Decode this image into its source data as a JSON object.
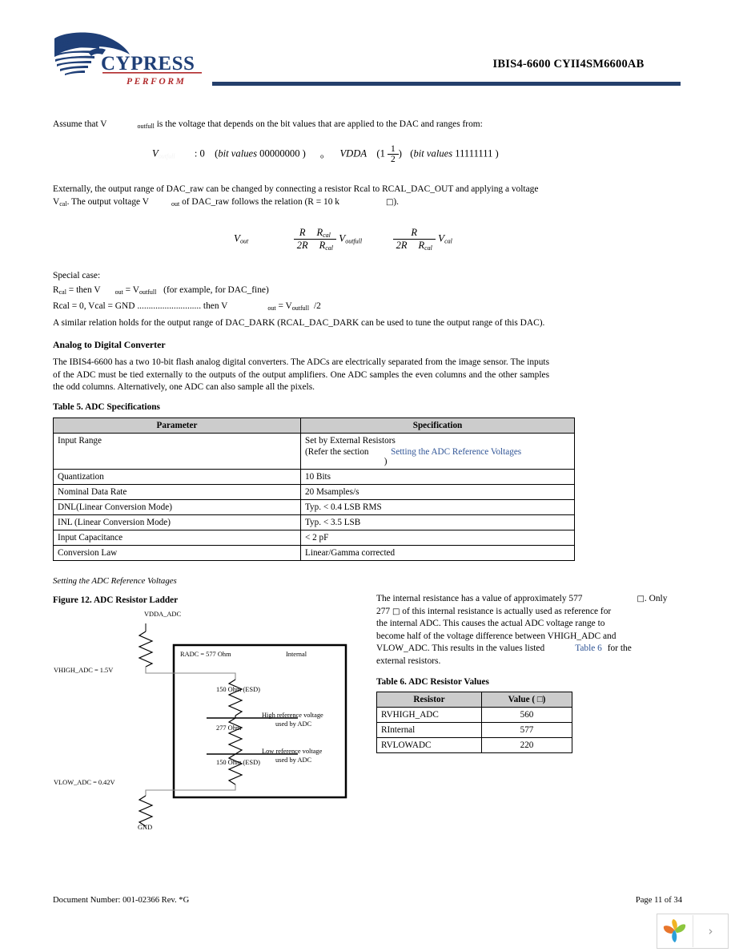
{
  "header": {
    "title": "IBIS4-6600 CYII4SM6600AB",
    "logo_name": "CYPRESS",
    "logo_tagline": "PERFORM",
    "accent_color": "#243f6c"
  },
  "body": {
    "assume_line": {
      "prefix": "Assume that V",
      "subscript": "outfull",
      "suffix": "is the voltage that depends on the bit values that are applied to the DAC and ranges from:"
    },
    "formula_range": {
      "var": "V",
      "var_sub": "outfull",
      "low": ": 0",
      "low_bits_label": "bit values",
      "low_bits": "00000000",
      "op": "o",
      "high_ref": "VDDA",
      "high_paren_open": "(1",
      "frac_num": "1",
      "frac_den": "2",
      "high_paren_close": ")",
      "high_bits_label": "bit values",
      "high_bits": "11111111"
    },
    "external_para_line1": "Externally, the output range of DAC_raw can be changed by connecting a resistor Rcal to RCAL_DAC_OUT and applying a voltage",
    "external_para_line2_a": "V",
    "external_para_line2_sub": "cal",
    "external_para_line2_b": ". The output voltage V",
    "external_para_line2_sub2": "out",
    "external_para_line2_c": "of DAC_raw follows the relation (R = 10 k",
    "external_para_line2_ohm": "□",
    "external_para_line2_d": ").",
    "formula_vout": {
      "lhs": "V",
      "lhs_sub": "out",
      "t1_num_a": "R",
      "t1_num_b": "R",
      "t1_num_b_sub": "cal",
      "t1_den_a": "2R",
      "t1_den_b": "R",
      "t1_den_b_sub": "cal",
      "t1_mult": "V",
      "t1_mult_sub": "outfull",
      "t2_num": "R",
      "t2_den_a": "2R",
      "t2_den_b": "R",
      "t2_den_b_sub": "cal",
      "t2_mult": "V",
      "t2_mult_sub": "cal"
    },
    "special_case_heading": "Special case:",
    "special_case_line1": {
      "a": "R",
      "a_sub": "cal",
      "b": "= then V",
      "b_sub": "out",
      "c": "= V",
      "c_sub": "outfull",
      "d": "(for example, for DAC_fine)"
    },
    "special_case_line2": {
      "a": "Rcal = 0, Vcal = GND ............................ then V",
      "b_sub": "out",
      "c": "= V",
      "c_sub": "outfull",
      "d": "/2"
    },
    "similar_relation": "A similar relation holds for the output range of DAC_DARK (RCAL_DAC_DARK can be used to tune the output range of this DAC)."
  },
  "adc_section": {
    "heading": "Analog to Digital Converter",
    "paragraph": "The IBIS4-6600 has a two 10-bit flash analog digital converters. The ADCs are electrically separated from the image sensor. The inputs of the ADC must be tied externally to the outputs of the output amplifiers. One ADC samples the even columns and the other samples the odd columns. Alternatively, one ADC can also sample all the pixels."
  },
  "table5": {
    "caption": "Table 5. ADC Specifications",
    "columns": [
      "Parameter",
      "Specification"
    ],
    "rows": [
      {
        "parameter": "Input Range",
        "spec_line1": "Set by External Resistors",
        "spec_line2_prefix": "(Refer the section",
        "spec_link": "Setting the ADC Reference Voltages",
        "spec_line2_suffix": ")"
      },
      {
        "parameter": "Quantization",
        "spec_line1": "10 Bits"
      },
      {
        "parameter": "Nominal Data Rate",
        "spec_line1": "20 Msamples/s"
      },
      {
        "parameter": "DNL(Linear Conversion Mode)",
        "spec_line1": "Typ. < 0.4 LSB RMS"
      },
      {
        "parameter": "INL (Linear Conversion Mode)",
        "spec_line1": "Typ. < 3.5 LSB"
      },
      {
        "parameter": "Input Capacitance",
        "spec_line1": "< 2 pF"
      },
      {
        "parameter": "Conversion Law",
        "spec_line1": "Linear/Gamma corrected"
      }
    ]
  },
  "subsection_italic": "Setting the ADC Reference Voltages",
  "figure12": {
    "caption": "Figure 12.  ADC Resistor Ladder",
    "labels": {
      "vdda": "VDDA_ADC",
      "vhigh": "VHIGH_ADC = 1.5V",
      "vlow": "VLOW_ADC = 0.42V",
      "gnd": "GND",
      "radc": "RADC = 577 Ohm",
      "internal": "Internal",
      "r_top": "150 Ohm (ESD)",
      "r_mid": "277 Ohm",
      "r_bot": "150 Ohm (ESD)",
      "high_ref_l1": "High reference voltage",
      "high_ref_l2": "used by ADC",
      "low_ref_l1": "Low reference voltage",
      "low_ref_l2": "used by ADC"
    }
  },
  "internal_resistance_para": {
    "line1_a": "The internal resistance has a value of approximately 577",
    "line1_ohm": "□",
    "line1_b": ". Only",
    "line2_a": "277",
    "line2_ohm": "□",
    "line2_b": "of this internal resistance is actually used as reference for",
    "line3": "the internal ADC. This causes the actual ADC voltage range to",
    "line4": "become half of the voltage difference between VHIGH_ADC and",
    "line5_a": "VLOW_ADC. This results in the values listed",
    "line5_link": "Table 6",
    "line5_b": "for the",
    "line6": "external resistors."
  },
  "table6": {
    "caption": "Table 6. ADC Resistor Values",
    "columns": [
      "Resistor",
      "Value ( □)"
    ],
    "rows": [
      {
        "resistor": "RVHIGH_ADC",
        "value": "560"
      },
      {
        "resistor": "RInternal",
        "value": "577"
      },
      {
        "resistor": "RVLOWADC",
        "value": "220"
      }
    ]
  },
  "footer": {
    "left": "Document Number: 001-02366  Rev. *G",
    "right": "Page 11 of 34"
  },
  "widget": {
    "next_glyph": "›"
  }
}
